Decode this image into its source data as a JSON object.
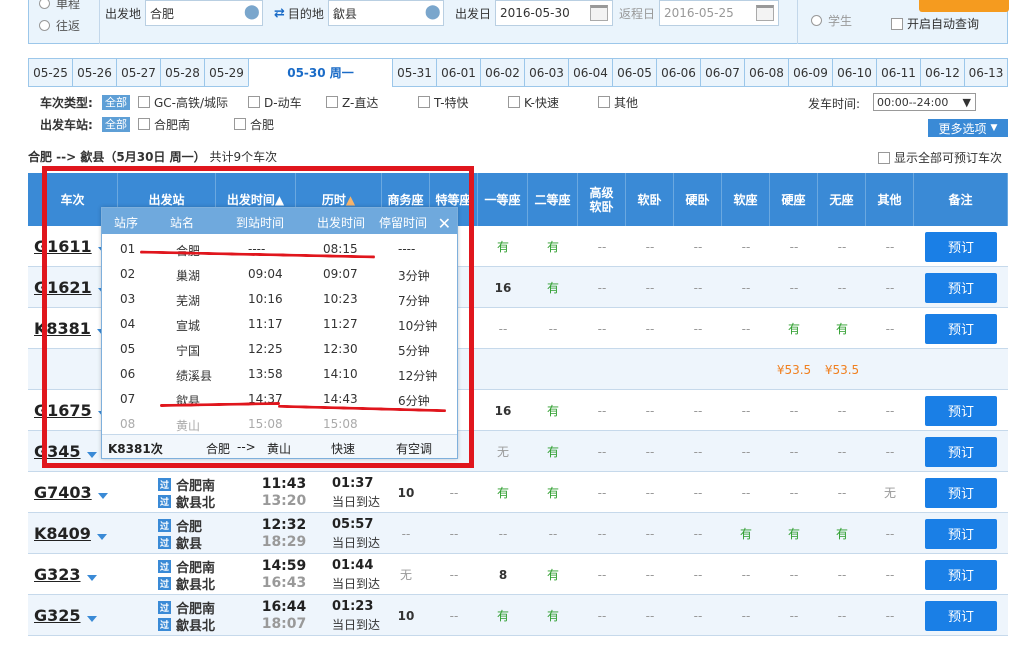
{
  "search": {
    "trip_one_way": "单程",
    "trip_round": "往返",
    "from_label": "出发地",
    "from_value": "合肥",
    "to_label": "目的地",
    "to_value": "歙县",
    "depart_label": "出发日",
    "depart_value": "2016-05-30",
    "return_label": "返程日",
    "return_value": "2016-05-25",
    "passenger_student": "学生",
    "auto_query": "开启自动查询"
  },
  "date_tabs": [
    "05-25",
    "05-26",
    "05-27",
    "05-28",
    "05-29",
    "05-30 周一",
    "05-31",
    "06-01",
    "06-02",
    "06-03",
    "06-04",
    "06-05",
    "06-06",
    "06-07",
    "06-08",
    "06-09",
    "06-10",
    "06-11",
    "06-12",
    "06-13"
  ],
  "filters": {
    "type_label": "车次类型:",
    "all": "全部",
    "types": [
      "GC-高铁/城际",
      "D-动车",
      "Z-直达",
      "T-特快",
      "K-快速",
      "其他"
    ],
    "station_label": "出发车站:",
    "stations": [
      "合肥南",
      "合肥"
    ],
    "time_label": "发车时间:",
    "time_value": "00:00--24:00",
    "more": "更多选项"
  },
  "summary": {
    "route": "合肥 --> 歙县（5月30日 周一）",
    "count": "共计9个车次",
    "show_all": "显示全部可预订车次"
  },
  "table_headers": {
    "train": "车次",
    "station": "出发站",
    "time": "出发时间",
    "duration": "历时",
    "business": "商务座",
    "special": "特等座",
    "first": "一等座",
    "second": "二等座",
    "senior_sleeper": "高级软卧",
    "soft_sleeper": "软卧",
    "hard_sleeper": "硬卧",
    "soft_seat": "软座",
    "hard_seat": "硬座",
    "no_seat": "无座",
    "other": "其他",
    "remark": "备注"
  },
  "book_label": "预订",
  "rows": [
    {
      "train": "G1611",
      "first": "有",
      "second": "有",
      "rest": [
        "--",
        "--",
        "--",
        "--",
        "--",
        "--",
        "--",
        "--"
      ]
    },
    {
      "train": "G1621",
      "first": "16",
      "second": "有",
      "rest": [
        "--",
        "--",
        "--",
        "--",
        "--",
        "--",
        "--",
        "--"
      ]
    },
    {
      "train": "K8381",
      "first": "--",
      "second": "--",
      "rest": [
        "--",
        "--",
        "--",
        "--",
        "有",
        "有",
        "--"
      ]
    },
    {
      "price_hard": "¥53.5",
      "price_none": "¥53.5"
    },
    {
      "train": "G1675",
      "first": "16",
      "second": "有",
      "rest": [
        "--",
        "--",
        "--",
        "--",
        "--",
        "--",
        "--",
        "--"
      ]
    },
    {
      "train": "G345",
      "first": "无",
      "second": "有",
      "rest": [
        "--",
        "--",
        "--",
        "--",
        "--",
        "--",
        "--",
        "--"
      ]
    },
    {
      "train": "G7403",
      "from": "合肥南",
      "to": "歙县北",
      "dep": "11:43",
      "arr": "13:20",
      "dur": "01:37",
      "arrive_note": "当日到达",
      "business": "10",
      "special": "--",
      "first": "有",
      "second": "有",
      "rest": [
        "--",
        "--",
        "--",
        "--",
        "--",
        "--",
        "无",
        "--"
      ]
    },
    {
      "train": "K8409",
      "from": "合肥",
      "to": "歙县",
      "dep": "12:32",
      "arr": "18:29",
      "dur": "05:57",
      "arrive_note": "当日到达",
      "business": "--",
      "special": "--",
      "first": "--",
      "second": "--",
      "rest": [
        "--",
        "--",
        "--",
        "有",
        "有",
        "有",
        "--"
      ]
    },
    {
      "train": "G323",
      "from": "合肥南",
      "to": "歙县北",
      "dep": "14:59",
      "arr": "16:43",
      "dur": "01:44",
      "arrive_note": "当日到达",
      "business": "无",
      "special": "--",
      "first": "8",
      "second": "有",
      "rest": [
        "--",
        "--",
        "--",
        "--",
        "--",
        "--",
        "--",
        "--"
      ]
    },
    {
      "train": "G325",
      "from": "合肥南",
      "to": "歙县北",
      "dep": "16:44",
      "arr": "18:07",
      "dur": "01:23",
      "arrive_note": "当日到达",
      "business": "10",
      "special": "--",
      "first": "有",
      "second": "有",
      "rest": [
        "--",
        "--",
        "--",
        "--",
        "--",
        "--",
        "--",
        "--"
      ]
    }
  ],
  "popup": {
    "headers": [
      "站序",
      "站名",
      "到站时间",
      "出发时间",
      "停留时间"
    ],
    "stops": [
      [
        "01",
        "合肥",
        "----",
        "08:15",
        "----"
      ],
      [
        "02",
        "巢湖",
        "09:04",
        "09:07",
        "3分钟"
      ],
      [
        "03",
        "芜湖",
        "10:16",
        "10:23",
        "7分钟"
      ],
      [
        "04",
        "宣城",
        "11:17",
        "11:27",
        "10分钟"
      ],
      [
        "05",
        "宁国",
        "12:25",
        "12:30",
        "5分钟"
      ],
      [
        "06",
        "绩溪县",
        "13:58",
        "14:10",
        "12分钟"
      ],
      [
        "07",
        "歙县",
        "14:37",
        "14:43",
        "6分钟"
      ],
      [
        "08",
        "黄山",
        "15:08",
        "15:08",
        ""
      ]
    ],
    "footer": {
      "train": "K8381次",
      "from": "合肥",
      "arrow": "-->",
      "to": "黄山",
      "type": "快速",
      "ac": "有空调"
    }
  }
}
